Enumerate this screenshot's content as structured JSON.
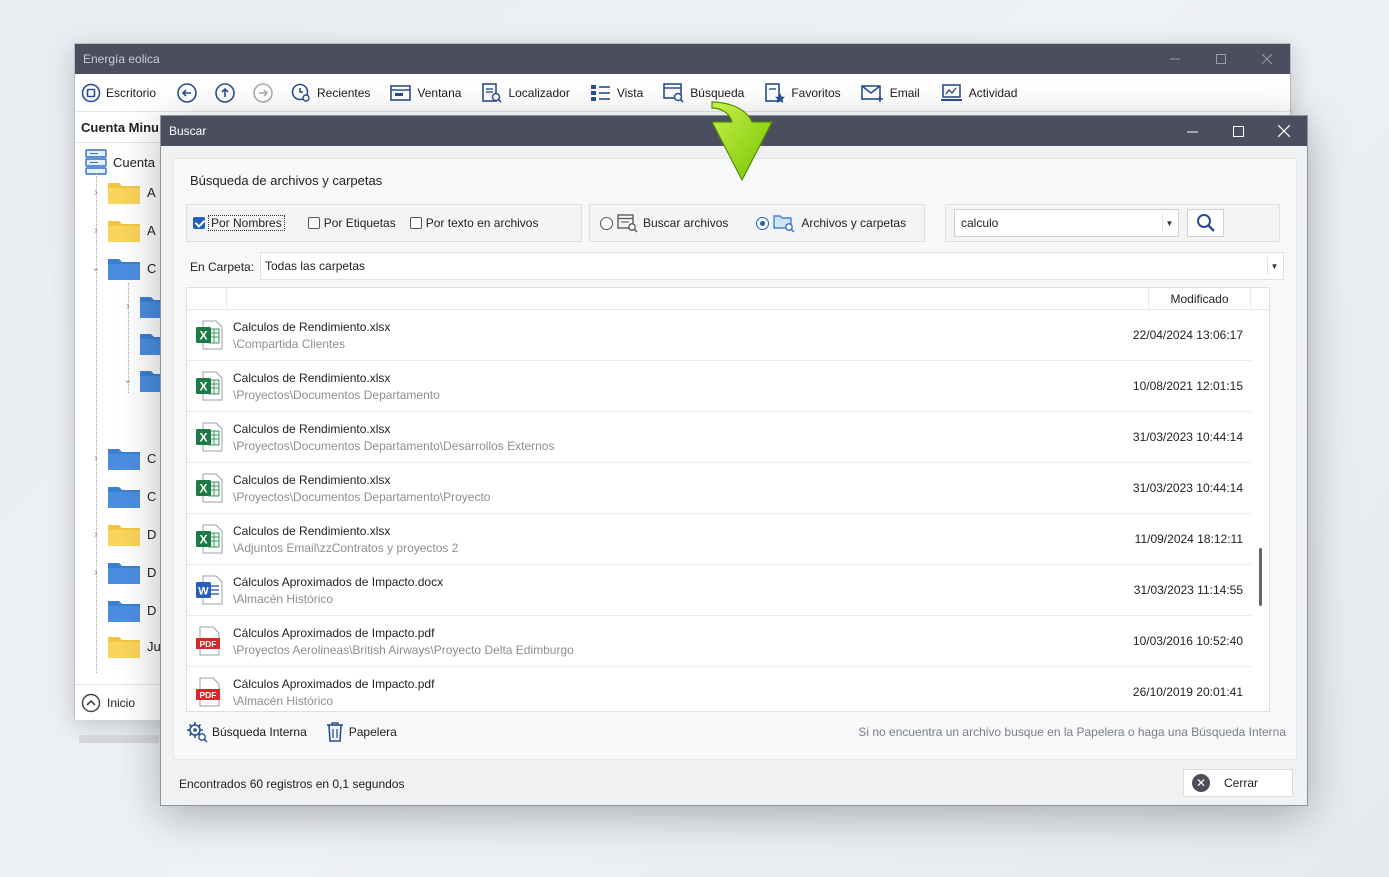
{
  "main_window": {
    "title": "Energía eolica",
    "toolbar": [
      {
        "label": "Escritorio",
        "icon": "desktop-icon"
      },
      {
        "label": "Recientes",
        "icon": "recent-icon"
      },
      {
        "label": "Ventana",
        "icon": "window-icon"
      },
      {
        "label": "Localizador",
        "icon": "locator-icon"
      },
      {
        "label": "Vista",
        "icon": "view-icon"
      },
      {
        "label": "Búsqueda",
        "icon": "search-doc-icon"
      },
      {
        "label": "Favoritos",
        "icon": "favorites-icon"
      },
      {
        "label": "Email",
        "icon": "email-icon"
      },
      {
        "label": "Actividad",
        "icon": "activity-icon"
      }
    ],
    "account_header": "Cuenta Minu",
    "tree_root": "Cuenta",
    "tree_letters": [
      "A",
      "A",
      "C",
      "C",
      "C",
      "D",
      "D",
      "D",
      "Ju"
    ],
    "footer_label": "Inicio"
  },
  "dialog": {
    "title": "Buscar",
    "heading": "Búsqueda de archivos y carpetas",
    "criteria": [
      {
        "label": "Por Nombres",
        "checked": true
      },
      {
        "label": "Por Etiquetas",
        "checked": false
      },
      {
        "label": "Por texto en archivos",
        "checked": false
      }
    ],
    "types": [
      {
        "label": "Buscar archivos",
        "selected": false
      },
      {
        "label": "Archivos y carpetas",
        "selected": true
      }
    ],
    "query": "calculo",
    "folder_label": "En Carpeta:",
    "folder_value": "Todas las carpetas",
    "column_modified": "Modificado",
    "results": [
      {
        "name": "Calculos de Rendimiento.xlsx",
        "path": "\\Compartida Clientes",
        "date": "22/04/2024 13:06:17",
        "type": "excel"
      },
      {
        "name": "Calculos de Rendimiento.xlsx",
        "path": "\\Proyectos\\Documentos Departamento",
        "date": "10/08/2021 12:01:15",
        "type": "excel"
      },
      {
        "name": "Calculos de Rendimiento.xlsx",
        "path": "\\Proyectos\\Documentos Departamento\\Desarrollos Externos",
        "date": "31/03/2023 10:44:14",
        "type": "excel"
      },
      {
        "name": "Calculos de Rendimiento.xlsx",
        "path": "\\Proyectos\\Documentos Departamento\\Proyecto",
        "date": "31/03/2023 10:44:14",
        "type": "excel"
      },
      {
        "name": "Calculos de Rendimiento.xlsx",
        "path": "\\Adjuntos Email\\zzContratos y proyectos 2",
        "date": "11/09/2024 18:12:11",
        "type": "excel"
      },
      {
        "name": "Cálculos Aproximados de Impacto.docx",
        "path": "\\Almacén Histórico",
        "date": "31/03/2023 11:14:55",
        "type": "word"
      },
      {
        "name": "Cálculos Aproximados de Impacto.pdf",
        "path": "\\Proyectos Aerolineas\\British Airways\\Proyecto Delta Edimburgo",
        "date": "10/03/2016 10:52:40",
        "type": "pdf"
      },
      {
        "name": "Cálculos Aproximados de Impacto.pdf",
        "path": "\\Almacén Histórico",
        "date": "26/10/2019 20:01:41",
        "type": "pdf"
      }
    ],
    "internal_search_label": "Búsqueda Interna",
    "trash_label": "Papelera",
    "hint": "Si no encuentra un archivo busque en la Papelera o haga una Búsqueda Interna",
    "status": "Encontrados 60 registros en 0,1 segundos",
    "close_label": "Cerrar",
    "icon_texts": {
      "excel": "X",
      "word": "W",
      "pdf": "PDF"
    }
  },
  "colors": {
    "titlebar": "#4b4e5f",
    "accent_blue": "#1f5fbf",
    "arrow_green": "#8ad400",
    "excel": "#1d7a45",
    "word": "#2b5cb8",
    "pdf": "#d62828"
  }
}
